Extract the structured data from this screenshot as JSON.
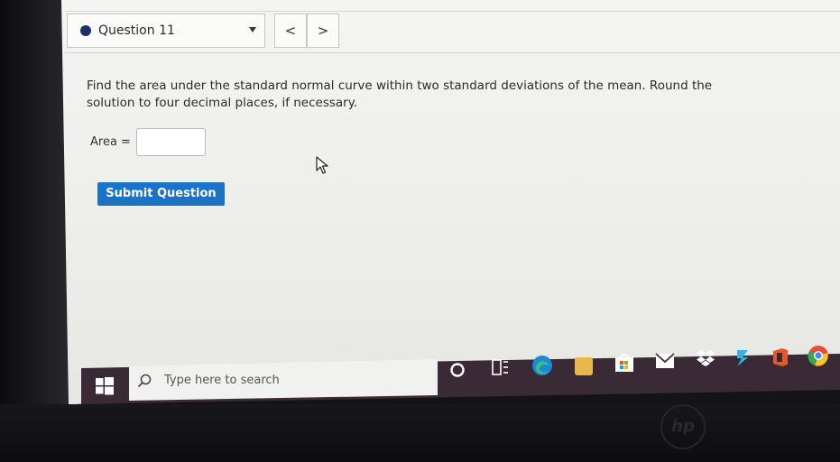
{
  "question_bar": {
    "label": "Question 11",
    "prev_symbol": "<",
    "next_symbol": ">"
  },
  "question": {
    "text": "Find the area under the standard normal curve within two standard deviations of the mean. Round the solution to four decimal places, if necessary.",
    "area_label": "Area =",
    "area_value": ""
  },
  "submit_label": "Submit Question",
  "taskbar": {
    "search_placeholder": "Type here to search",
    "icons": [
      "cortana-circle-icon",
      "task-view-icon",
      "edge-icon",
      "file-explorer-icon",
      "store-icon",
      "mail-icon",
      "dropbox-icon",
      "app-icon",
      "office-icon",
      "chrome-icon"
    ]
  },
  "colors": {
    "accent": "#1a73c4",
    "question_dot": "#1d2f6e"
  },
  "brand": "hp"
}
